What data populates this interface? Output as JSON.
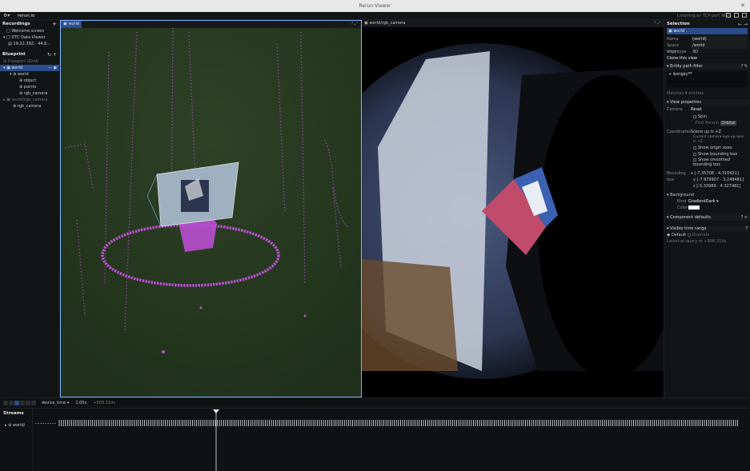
{
  "window": {
    "title": "Rerun Viewer"
  },
  "topbar": {
    "app_name": "rerun.io",
    "status": "Listening on TCP port 9876"
  },
  "left_panel": {
    "recordings_title": "Recordings",
    "recordings": [
      {
        "label": "Welcome screen"
      },
      {
        "label": "DTC Data Viewer"
      },
      {
        "label": "19:22:36Z - 44.8..."
      }
    ],
    "blueprint_title": "Blueprint",
    "viewport_label": "Viewport (Grid)",
    "world_label": "world",
    "world_children": [
      "world",
      "object",
      "points",
      "rgb_camera"
    ],
    "rgb_view_label": "world/rgb_camera",
    "rgb_children": [
      "rgb_camera"
    ]
  },
  "view3d": {
    "tab": "world"
  },
  "view2d": {
    "tab": "world/rgb_camera"
  },
  "right_panel": {
    "selection_title": "Selection",
    "selected_badge": "world",
    "name_label": "Name",
    "name_value": "(world)",
    "space_origin_label": "Space origin",
    "space_origin_value": "/world",
    "view_type_label": "View type",
    "view_type_value": "3D",
    "clone_label": "Clone this view",
    "entity_filter_title": "Entity path filter",
    "filter_query": "+ $origin/**",
    "matches": "Matches 4 entities",
    "view_properties_title": "View properties",
    "camera_label": "Camera",
    "camera_reset": "Reset",
    "spin_label": "Spin",
    "first_person": "First Person",
    "orbital": "Orbital",
    "coords_label": "Coordinates",
    "coords_value": "Scene up is +Z",
    "coords_note": "Current camera-eye-up-axis is +Z",
    "show_origin_axes": "Show origin axes",
    "show_bounding_box": "Show bounding box",
    "show_smoothed_box": "Show smoothed bounding box",
    "bbox_label": "Bounding box",
    "bbox_x": "x [-7.35708 - 4.310421]",
    "bbox_y": "y [-7.979907 - 3.248481]",
    "bbox_z": "z [-5.33989 - 4.327481]",
    "background_title": "Background",
    "kind_label": "Kind",
    "kind_value": "GradientDark",
    "color_label": "Color",
    "component_defaults": "Component defaults",
    "visible_time_range": "Visible time range",
    "default_label": "Default",
    "override_label": "Override",
    "latest_at": "Latest-at query at +808.31ds"
  },
  "timeline": {
    "timeline_name": "device_time",
    "speed": "1.00x",
    "time_value": "+808.31ds",
    "streams_title": "Streams",
    "stream_row": "world/"
  },
  "colors": {
    "accent": "#2c4d8c",
    "point_color": "#b94fd0",
    "view_bg": "#27391f"
  }
}
